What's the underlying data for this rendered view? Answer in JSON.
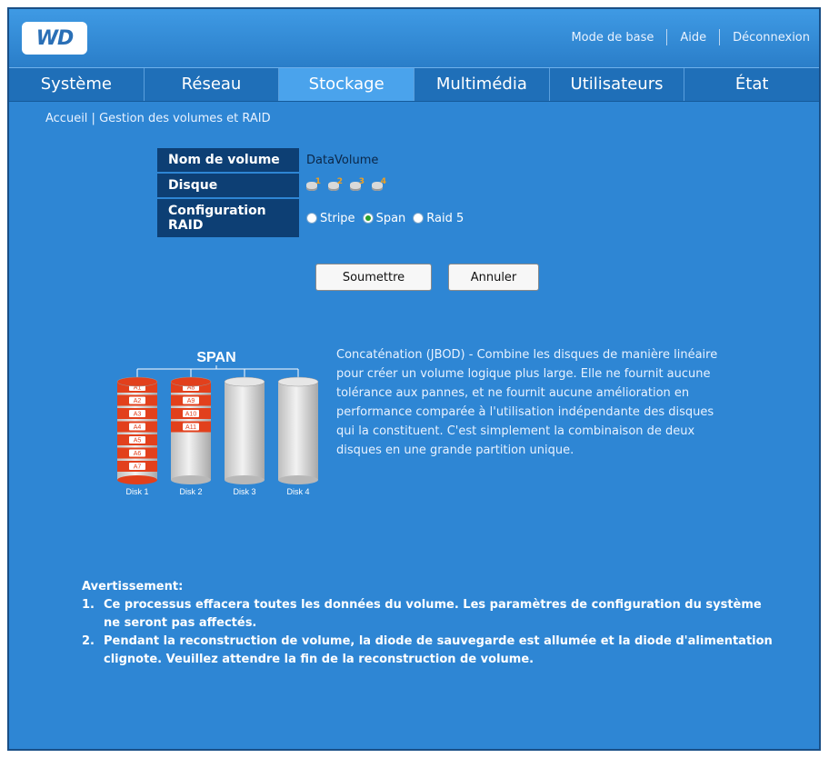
{
  "header": {
    "logo_text": "WD",
    "links": [
      "Mode de base",
      "Aide",
      "Déconnexion"
    ]
  },
  "nav": {
    "tabs": [
      "Système",
      "Réseau",
      "Stockage",
      "Multimédia",
      "Utilisateurs",
      "État"
    ],
    "active": "Stockage"
  },
  "breadcrumb": "Accueil | Gestion des volumes et RAID",
  "form": {
    "volume_name_label": "Nom de volume",
    "volume_name_value": "DataVolume",
    "disk_label": "Disque",
    "disks": [
      "1",
      "2",
      "3",
      "4"
    ],
    "raid_label_line1": "Configuration",
    "raid_label_line2": "RAID",
    "raid_options": [
      "Stripe",
      "Span",
      "Raid 5"
    ],
    "raid_selected": "Span",
    "submit_label": "Soumettre",
    "cancel_label": "Annuler"
  },
  "diagram": {
    "title": "SPAN",
    "disks": [
      {
        "label": "Disk 1",
        "blocks": [
          "A1",
          "A2",
          "A3",
          "A4",
          "A5",
          "A6",
          "A7"
        ]
      },
      {
        "label": "Disk 2",
        "blocks": [
          "A8",
          "A9",
          "A10",
          "A11"
        ]
      },
      {
        "label": "Disk 3",
        "blocks": []
      },
      {
        "label": "Disk 4",
        "blocks": []
      }
    ]
  },
  "description": "Concaténation (JBOD) - Combine les disques de manière linéaire pour créer un volume logique plus large. Elle ne fournit aucune tolérance aux pannes, et ne fournit aucune amélioration en performance comparée à l'utilisation indépendante des disques qui la constituent. C'est simplement la combinaison de deux disques en une grande partition unique.",
  "warning": {
    "title": "Avertissement:",
    "items": [
      {
        "num": "1.",
        "text": "Ce processus effacera toutes les données du volume. Les paramètres de configuration du système ne seront pas affectés."
      },
      {
        "num": "2.",
        "text": "Pendant la reconstruction de volume, la diode de sauvegarde est allumée et la diode d'alimentation clignote. Veuillez attendre la fin de la reconstruction de volume."
      }
    ]
  },
  "colors": {
    "background": "#2e86d4",
    "label_bg": "#0d3f74",
    "active_tab": "#4aa3ec",
    "block_red": "#e2401c"
  }
}
